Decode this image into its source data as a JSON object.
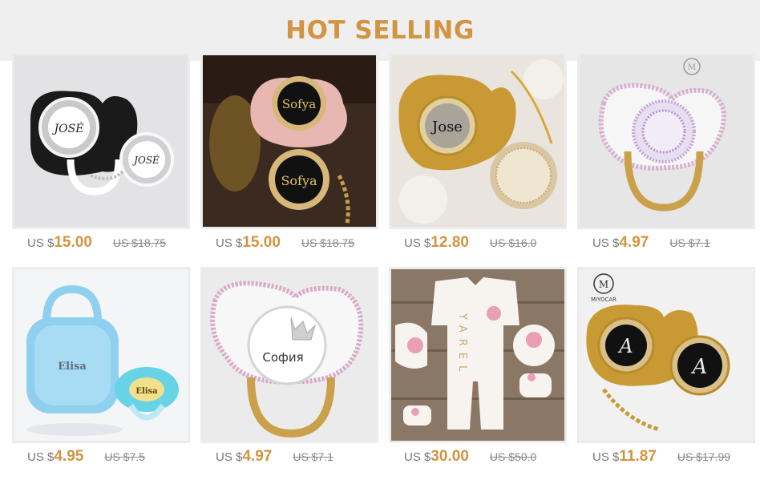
{
  "header": {
    "title": "HOT SELLING"
  },
  "products": [
    {
      "image": "pacifier-jose-silver-black",
      "currency": "US $",
      "price": "15.00",
      "old_price": "US $18.75"
    },
    {
      "image": "pacifier-sofya-rose-gold",
      "currency": "US $",
      "price": "15.00",
      "old_price": "US $18.75"
    },
    {
      "image": "pacifier-jose-gold-rhinestone",
      "currency": "US $",
      "price": "12.80",
      "old_price": "US $16.0"
    },
    {
      "image": "pacifier-crystal-bling-white",
      "currency": "US $",
      "price": "4.97",
      "old_price": "US $7.1"
    },
    {
      "image": "pacifier-case-blue-elisa",
      "currency": "US $",
      "price": "4.95",
      "old_price": "US $7.5"
    },
    {
      "image": "pacifier-crown-sofia",
      "currency": "US $",
      "price": "4.97",
      "old_price": "US $7.1"
    },
    {
      "image": "baby-romper-set-yarel",
      "currency": "US $",
      "price": "30.00",
      "old_price": "US $50.0"
    },
    {
      "image": "pacifier-letter-a-gold",
      "currency": "US $",
      "price": "11.87",
      "old_price": "US $17.99"
    }
  ],
  "text_on_images": {
    "jose_caps": "JOSÉ",
    "sofya": "Sofya",
    "jose": "Jose",
    "elisa": "Elisa",
    "sofia_cyr": "София",
    "yarel": "YAREL",
    "letter_a": "A",
    "brand": "MIYOCAR"
  }
}
